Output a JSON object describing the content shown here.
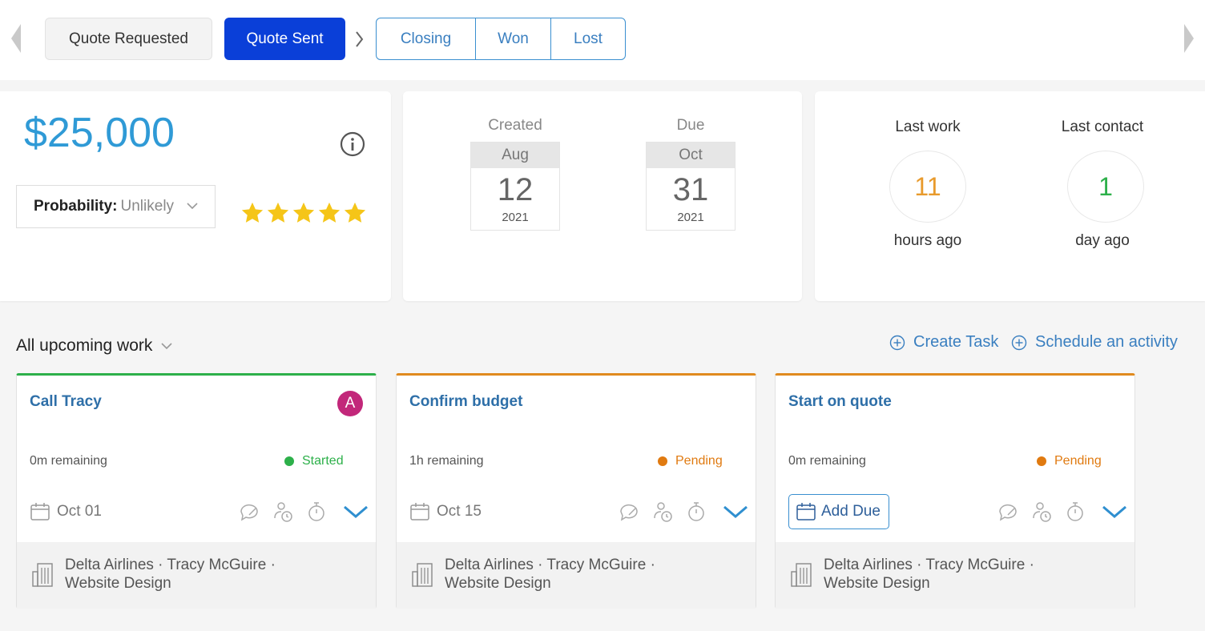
{
  "pipeline": {
    "stages": [
      {
        "label": "Quote Requested",
        "state": "done"
      },
      {
        "label": "Quote Sent",
        "state": "current"
      },
      {
        "label": "Closing",
        "state": "upcoming"
      },
      {
        "label": "Won",
        "state": "upcoming"
      },
      {
        "label": "Lost",
        "state": "upcoming"
      }
    ]
  },
  "deal": {
    "amount": "$25,000",
    "probability_label": "Probability:",
    "probability_value": "Unlikely",
    "rating": 5
  },
  "dates": {
    "created": {
      "label": "Created",
      "month": "Aug",
      "day": "12",
      "year": "2021"
    },
    "due": {
      "label": "Due",
      "month": "Oct",
      "day": "31",
      "year": "2021"
    }
  },
  "activity": {
    "last_work": {
      "label": "Last work",
      "value": "11",
      "unit": "hours ago",
      "color": "#e89a2c"
    },
    "last_contact": {
      "label": "Last contact",
      "value": "1",
      "unit": "day ago",
      "color": "#2db04a"
    }
  },
  "work": {
    "filter_label": "All upcoming work",
    "create_task": "Create Task",
    "schedule_activity": "Schedule an activity",
    "tasks": [
      {
        "title": "Call Tracy",
        "assignee": "A",
        "remaining": "0m remaining",
        "status": "Started",
        "status_color": "#2db04a",
        "due": "Oct 01",
        "related": "Delta Airlines · Tracy McGuire · Website Design"
      },
      {
        "title": "Confirm budget",
        "remaining": "1h remaining",
        "status": "Pending",
        "status_color": "#e07a10",
        "due": "Oct 15",
        "related": "Delta Airlines · Tracy McGuire · Website Design"
      },
      {
        "title": "Start on quote",
        "remaining": "0m remaining",
        "status": "Pending",
        "status_color": "#e07a10",
        "add_due_label": "Add Due",
        "related": "Delta Airlines · Tracy McGuire · Website Design"
      }
    ]
  },
  "colors": {
    "accent": "#0a3fd8",
    "link": "#3a7fc0",
    "amount": "#2f9ad6",
    "star": "#f5c518"
  },
  "icons": [
    "nav-left-icon",
    "nav-right-icon",
    "chevron-right-icon",
    "info-icon",
    "chevron-down-icon",
    "star-icon",
    "plus-circle-icon",
    "calendar-icon",
    "comment-icon",
    "assign-time-icon",
    "stopwatch-icon",
    "expand-icon",
    "building-icon"
  ]
}
